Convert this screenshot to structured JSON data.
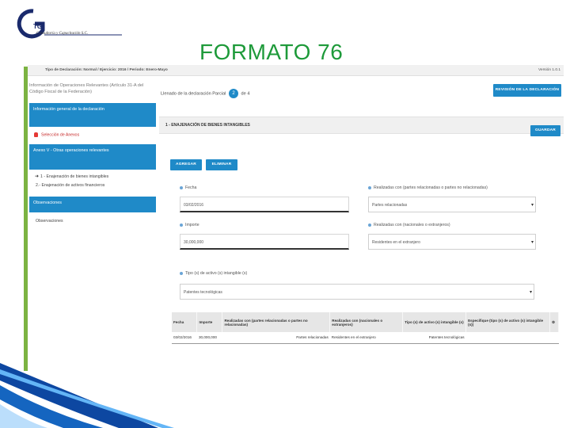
{
  "slide": {
    "title": "FORMATO 76",
    "logo_mark": "G",
    "logo_small": "TG",
    "logo_text": "Consultoría y Capacitación S.C."
  },
  "app": {
    "breadcrumb": "Tipo de Declaración: Normal / Ejercicio: 2016 / Periodo: Enero-Mayo",
    "version": "Versión 1.0.1",
    "sidebar": {
      "heading": "Información de Operaciones Relevantes (Artículo 31-A del Código Fiscal de la Federación)",
      "general_block": "Información general de la declaración",
      "selection_link": "Selección de Anexos",
      "annex_block": "Anexo V - Otras operaciones relevantes",
      "item_1": "1 - Enajenación de bienes intangibles",
      "item_2": "2.- Enajenación de activos financieros",
      "observations_block": "Observaciones",
      "observations_link": "Observaciones"
    },
    "main": {
      "status_prefix": "Llenado de la declaración Parcial",
      "status_step": "2",
      "status_suffix": "de 4",
      "review_button": "REVISIÓN DE LA DECLARACIÓN",
      "section_title": "1 - ENAJENACIÓN DE BIENES INTANGIBLES",
      "save_button": "GUARDAR",
      "add_button": "AGREGAR",
      "delete_button": "ELIMINAR",
      "fecha_label": "Fecha",
      "fecha_value": "03/02/2016",
      "realizadas_label": "Realizadas con (partes relacionadas o partes no relacionadas)",
      "realizadas_value": "Partes relacionadas",
      "importe_label": "Importe",
      "importe_value": "30,000,000",
      "residentes_label": "Realizadas con (nacionales o extranjeros)",
      "residentes_value": "Residentes en el extranjero",
      "tipo_label": "Tipo (s) de activo (s) intangible (s)",
      "tipo_value": "Patentes tecnológicas"
    },
    "table": {
      "headers": [
        "Fecha",
        "Importe",
        "Realizadas con (partes relacionadas o partes no relacionadas)",
        "Realizadas con (nacionales o extranjeros)",
        "Tipo (s) de activo (s) intangible (s)",
        "Especifique (tipo (s) de activo (s) intangible (s))",
        ""
      ],
      "rows": [
        [
          "03/02/2016",
          "30,000,000",
          "Partes relacionadas",
          "Residentes en el extranjero",
          "Patentes tecnológicas",
          "",
          ""
        ]
      ]
    }
  },
  "colors": {
    "accent_blue": "#1f8ac8",
    "title_green": "#1e9a3a",
    "bar_green": "#7cb342",
    "deco_blue": "#0d47a1"
  }
}
